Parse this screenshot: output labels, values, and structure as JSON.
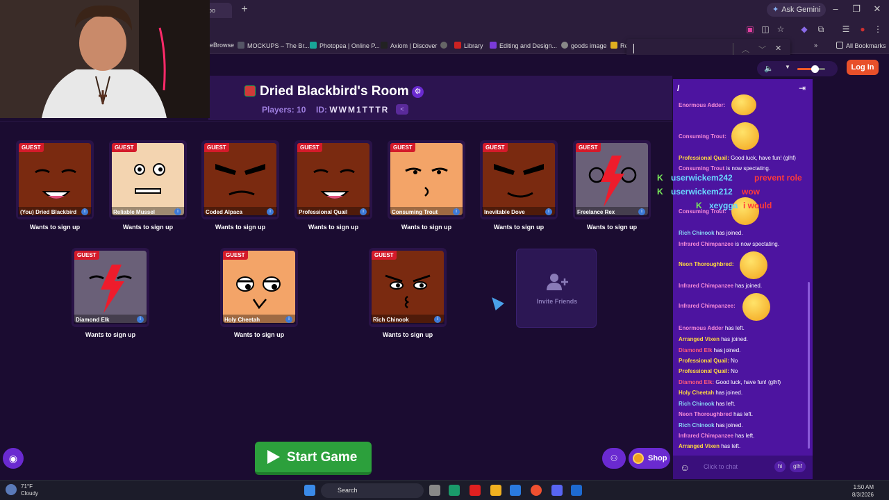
{
  "browser": {
    "tab_fragment": "oo",
    "ask_gemini": "Ask Gemini",
    "bookmarks": [
      {
        "label": "eBrowse",
        "color": "#3a3a5a"
      },
      {
        "label": "MOCKUPS – The Br...",
        "color": "#555566"
      },
      {
        "label": "Photopea | Online P...",
        "color": "#18a497"
      },
      {
        "label": "Axiom | Discover",
        "color": "#222222"
      },
      {
        "label": "",
        "color": "#666666"
      },
      {
        "label": "Library",
        "color": "#cc2222"
      },
      {
        "label": "Editing and Design...",
        "color": "#7a3ad8"
      },
      {
        "label": "goods image",
        "color": "#888888"
      },
      {
        "label": "Re",
        "color": "#e0b020"
      }
    ],
    "all_bookmarks": "All Bookmarks"
  },
  "room": {
    "title": "Dried Blackbird's Room",
    "players_label": "Players: 10",
    "id_label": "ID:",
    "id_value": "WWM1TTTR"
  },
  "players": [
    {
      "name": "(You) Dried Blackbird",
      "badge": "GUEST",
      "status": "Wants to sign up",
      "color": "#7a2a10"
    },
    {
      "name": "Reliable Mussel",
      "badge": "GUEST",
      "status": "Wants to sign up",
      "color": "#f3d4b0"
    },
    {
      "name": "Coded Alpaca",
      "badge": "GUEST",
      "status": "Wants to sign up",
      "color": "#7a2a10"
    },
    {
      "name": "Professional Quail",
      "badge": "GUEST",
      "status": "Wants to sign up",
      "color": "#7a2a10"
    },
    {
      "name": "Consuming Trout",
      "badge": "GUEST",
      "status": "Wants to sign up",
      "color": "#f3a468"
    },
    {
      "name": "Inevitable Dove",
      "badge": "GUEST",
      "status": "Wants to sign up",
      "color": "#7a2a10"
    },
    {
      "name": "Freelance Rex",
      "badge": "GUEST",
      "status": "Wants to sign up",
      "color": "#6a6078"
    },
    {
      "name": "Diamond Elk",
      "badge": "GUEST",
      "status": "Wants to sign up",
      "color": "#6a6078"
    },
    {
      "name": "Holy Cheetah",
      "badge": "GUEST",
      "status": "Wants to sign up",
      "color": "#f3a468"
    },
    {
      "name": "Rich Chinook",
      "badge": "GUEST",
      "status": "Wants to sign up",
      "color": "#7a2a10"
    }
  ],
  "invite_label": "Invite Friends",
  "start_game": "Start Game",
  "shop": "Shop",
  "login": "Log In",
  "chat": {
    "slash": "/",
    "messages": [
      {
        "user": "Enormous Adder:",
        "text": "",
        "color": "pink"
      },
      {
        "user": "Consuming Trout:",
        "text": "",
        "color": "pink"
      },
      {
        "user": "Professional Quail:",
        "text": " Good luck, have fun! (glhf)",
        "color": "yellow"
      },
      {
        "user": "Consuming Trout",
        "text": " is now spectating.",
        "color": "pink"
      },
      {
        "user": "Consuming Trout:",
        "text": "",
        "color": "pink"
      },
      {
        "user": "Rich Chinook",
        "text": " has joined.",
        "color": "blue"
      },
      {
        "user": "Infrared Chimpanzee",
        "text": " is now spectating.",
        "color": "pink"
      },
      {
        "user": "Neon Thoroughbred:",
        "text": "",
        "color": "yellow"
      },
      {
        "user": "Infrared Chimpanzee",
        "text": " has joined.",
        "color": "pink"
      },
      {
        "user": "Infrared Chimpanzee:",
        "text": "",
        "color": "pink"
      },
      {
        "user": "Enormous Adder",
        "text": " has left.",
        "color": "pink"
      },
      {
        "user": "Arranged Vixen",
        "text": " has joined.",
        "color": "yellow"
      },
      {
        "user": "Diamond Elk",
        "text": " has joined.",
        "color": "red"
      },
      {
        "user": "Professional Quail:",
        "text": " No",
        "color": "yellow"
      },
      {
        "user": "Professional Quail:",
        "text": " No",
        "color": "yellow"
      },
      {
        "user": "Diamond Elk:",
        "text": " Good luck, have fun! (glhf)",
        "color": "red"
      },
      {
        "user": "Holy Cheetah",
        "text": " has joined.",
        "color": "yellow"
      },
      {
        "user": "Rich Chinook",
        "text": " has left.",
        "color": "blue"
      },
      {
        "user": "Neon Thoroughbred",
        "text": " has left.",
        "color": "pink"
      },
      {
        "user": "Rich Chinook",
        "text": " has joined.",
        "color": "blue"
      },
      {
        "user": "Infrared Chimpanzee",
        "text": " has left.",
        "color": "pink"
      },
      {
        "user": "Arranged Vixen",
        "text": " has left.",
        "color": "yellow"
      }
    ],
    "placeholder": "Click to chat",
    "chip_hi": "hi",
    "chip_glhf": "glhf"
  },
  "overlay": {
    "line1": "userwickem242",
    "line1b": "prevent role",
    "line2": "userwickem212",
    "line2b": "wow",
    "line3": "xeygga",
    "line3b": "i would"
  },
  "taskbar": {
    "temp": "71°F",
    "condition": "Cloudy",
    "search": "Search",
    "time": "1:50 AM",
    "date": "8/3/2026"
  }
}
